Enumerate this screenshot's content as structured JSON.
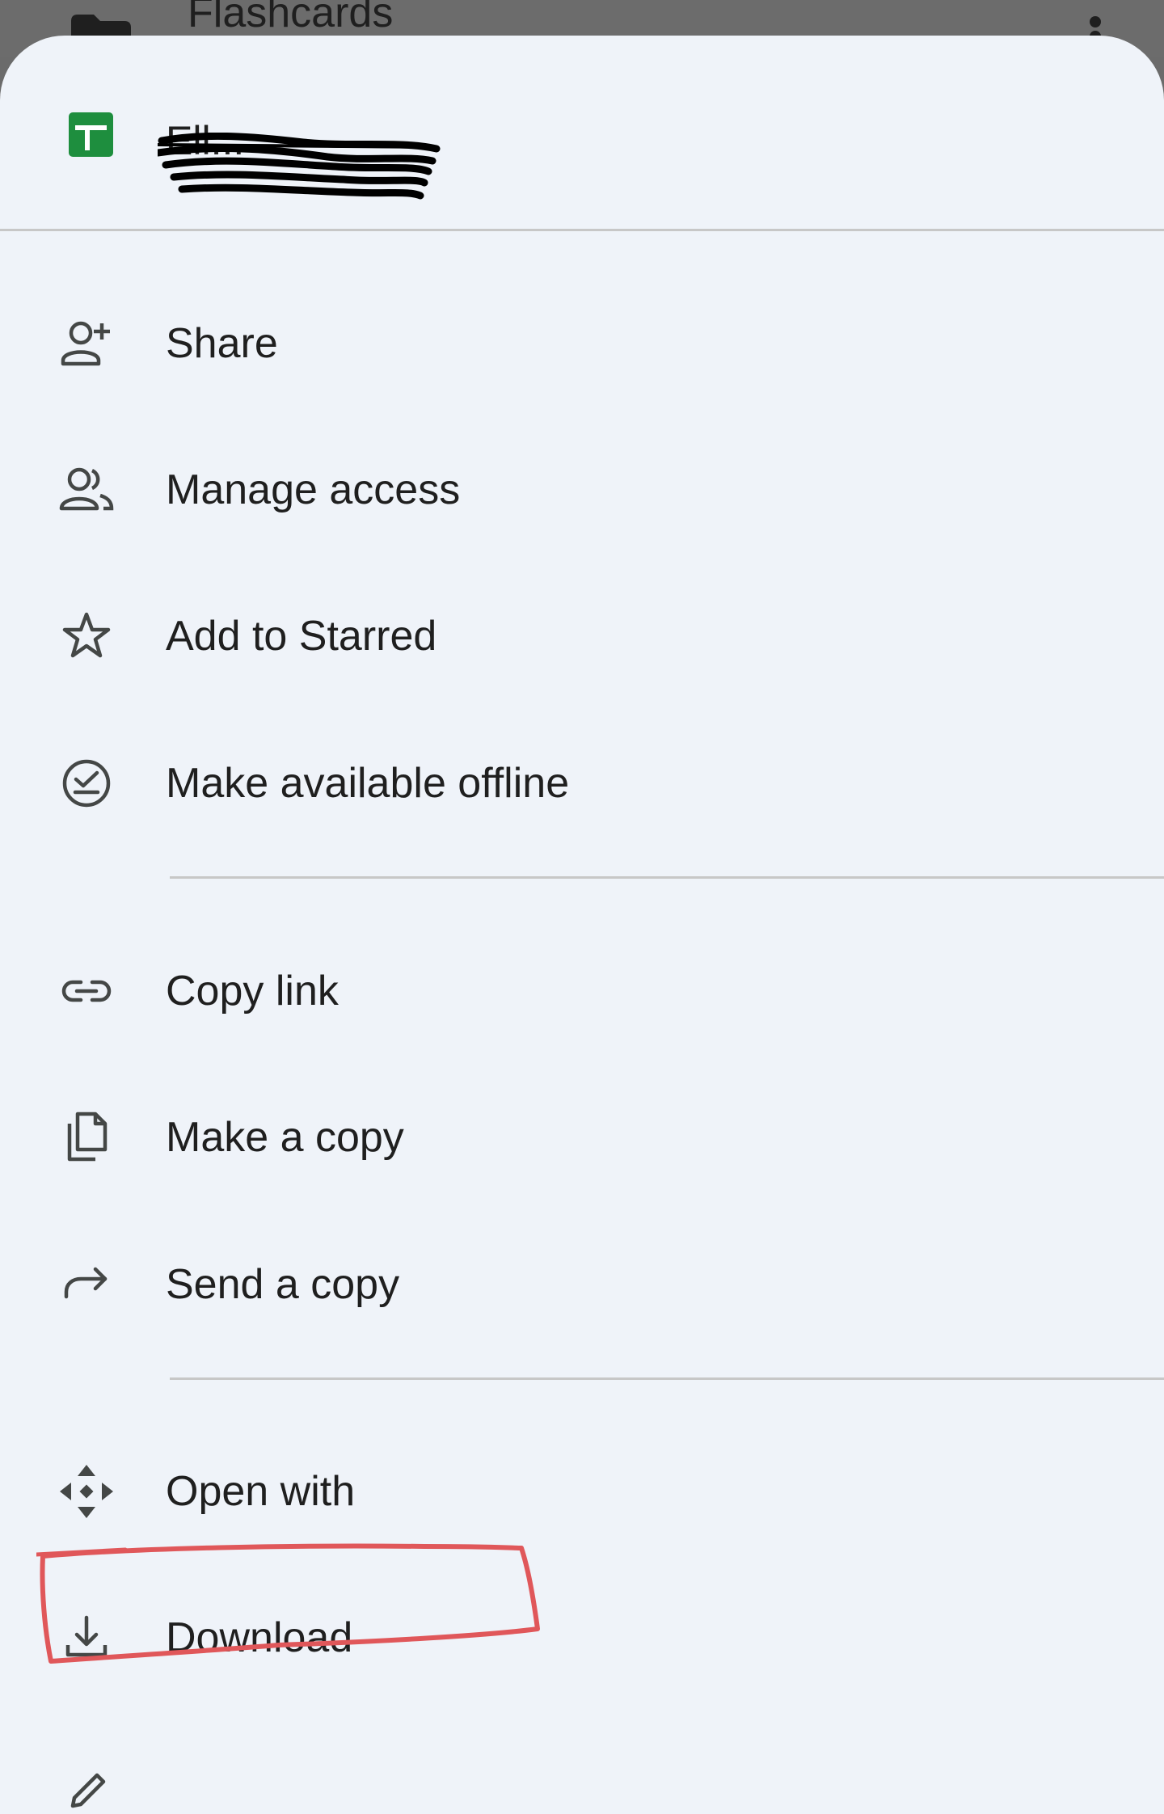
{
  "background_screen": {
    "title": "Flashcards"
  },
  "sheet": {
    "file_name": "Ell...",
    "file_type_icon": "google-sheets-icon",
    "accent_color": "#1e8e3e"
  },
  "menu": {
    "items": [
      {
        "label": "Share",
        "icon": "person-add-icon"
      },
      {
        "label": "Manage access",
        "icon": "people-icon"
      },
      {
        "label": "Add to Starred",
        "icon": "star-outline-icon"
      },
      {
        "label": "Make available offline",
        "icon": "offline-check-icon"
      },
      {
        "label": "Copy link",
        "icon": "link-icon"
      },
      {
        "label": "Make a copy",
        "icon": "copy-icon"
      },
      {
        "label": "Send a copy",
        "icon": "forward-arrow-icon"
      },
      {
        "label": "Open with",
        "icon": "open-with-icon"
      },
      {
        "label": "Download",
        "icon": "download-icon"
      }
    ]
  },
  "annotation": {
    "highlight_color": "#e0575a",
    "highlighted_item": "Download"
  }
}
